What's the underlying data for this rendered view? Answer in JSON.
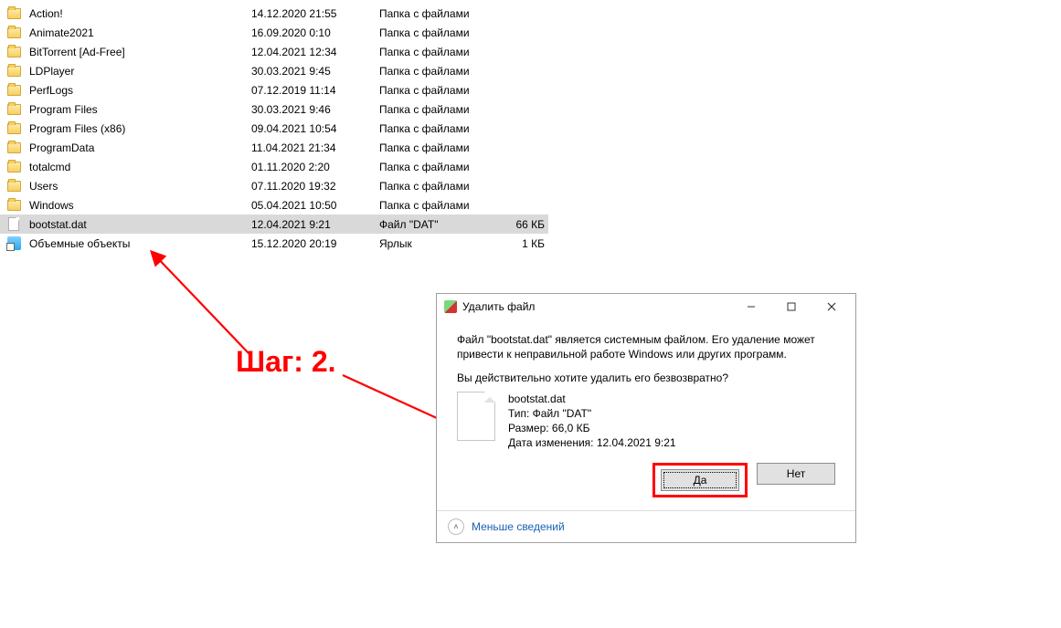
{
  "annotation": {
    "label": "Шаг: 2."
  },
  "files": [
    {
      "icon": "folder",
      "name": "Action!",
      "date": "14.12.2020 21:55",
      "type": "Папка с файлами",
      "size": ""
    },
    {
      "icon": "folder",
      "name": "Animate2021",
      "date": "16.09.2020 0:10",
      "type": "Папка с файлами",
      "size": ""
    },
    {
      "icon": "folder",
      "name": "BitTorrent [Ad-Free]",
      "date": "12.04.2021 12:34",
      "type": "Папка с файлами",
      "size": ""
    },
    {
      "icon": "folder",
      "name": "LDPlayer",
      "date": "30.03.2021 9:45",
      "type": "Папка с файлами",
      "size": ""
    },
    {
      "icon": "folder",
      "name": "PerfLogs",
      "date": "07.12.2019 11:14",
      "type": "Папка с файлами",
      "size": ""
    },
    {
      "icon": "folder",
      "name": "Program Files",
      "date": "30.03.2021 9:46",
      "type": "Папка с файлами",
      "size": ""
    },
    {
      "icon": "folder",
      "name": "Program Files (x86)",
      "date": "09.04.2021 10:54",
      "type": "Папка с файлами",
      "size": ""
    },
    {
      "icon": "folder",
      "name": "ProgramData",
      "date": "11.04.2021 21:34",
      "type": "Папка с файлами",
      "size": ""
    },
    {
      "icon": "folder",
      "name": "totalcmd",
      "date": "01.11.2020 2:20",
      "type": "Папка с файлами",
      "size": ""
    },
    {
      "icon": "folder",
      "name": "Users",
      "date": "07.11.2020 19:32",
      "type": "Папка с файлами",
      "size": ""
    },
    {
      "icon": "folder",
      "name": "Windows",
      "date": "05.04.2021 10:50",
      "type": "Папка с файлами",
      "size": ""
    },
    {
      "icon": "file",
      "name": "bootstat.dat",
      "date": "12.04.2021 9:21",
      "type": "Файл \"DAT\"",
      "size": "66 КБ",
      "selected": true
    },
    {
      "icon": "shortcut",
      "name": "Объемные объекты",
      "date": "15.12.2020 20:19",
      "type": "Ярлык",
      "size": "1 КБ"
    }
  ],
  "dialog": {
    "title": "Удалить файл",
    "warning": "Файл \"bootstat.dat\" является системным файлом. Его удаление может привести к неправильной работе Windows или других программ.",
    "question": "Вы действительно хотите удалить его безвозвратно?",
    "file": {
      "name": "bootstat.dat",
      "type_label": "Тип: Файл \"DAT\"",
      "size_label": "Размер: 66,0 КБ",
      "date_label": "Дата изменения: 12.04.2021 9:21"
    },
    "yes": "Да",
    "no": "Нет",
    "less": "Меньше сведений"
  }
}
